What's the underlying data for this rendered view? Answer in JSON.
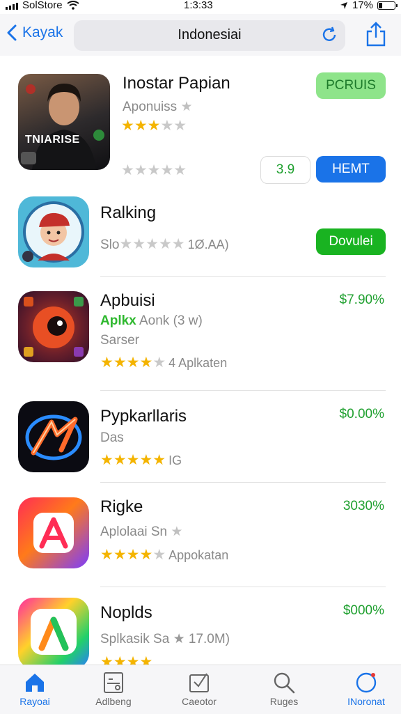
{
  "status_bar": {
    "carrier": "SolStore",
    "time": "1:3:33",
    "battery": "17%"
  },
  "nav": {
    "back_label": "Kayak",
    "url": "Indonesiai"
  },
  "apps": [
    {
      "title": "Inostar Papian",
      "subtitle": "Aponuiss",
      "rating_text": "",
      "secondary_rating_text": "",
      "button_top": "PCRUIS",
      "price_box": "3.9",
      "button_bottom": "HEMT"
    },
    {
      "title": "Ralking",
      "rating_prefix": "Slo",
      "rating_text": "1Ø.AA)",
      "button": "Dovulei"
    },
    {
      "title": "Apbuisi",
      "subtitle_green": "Aplkx",
      "subtitle_gray": "Aonk (3 w)",
      "subtitle2": "Sarser",
      "rating_text": "4 Aplkaten",
      "price": "$7.90%"
    },
    {
      "title": "Pypkarllaris",
      "subtitle": "Das",
      "rating_text": "IG",
      "price": "$0.00%"
    },
    {
      "title": "Rigke",
      "subtitle": "Aplolaai Sn",
      "rating_text": "Appokatan",
      "price": "3030%"
    },
    {
      "title": "Noplds",
      "subtitle": "Splkasik Sa",
      "rating_text": "17.0M)",
      "price": "$000%"
    }
  ],
  "icon_texts": {
    "app1_banner": "TNIARISE"
  },
  "tabs": [
    {
      "label": "Rayoai",
      "icon": "home-icon",
      "active": true
    },
    {
      "label": "Adlbeng",
      "icon": "card-icon",
      "active": false
    },
    {
      "label": "Caeotor",
      "icon": "edit-icon",
      "active": false
    },
    {
      "label": "Ruges",
      "icon": "search-icon",
      "active": false
    },
    {
      "label": "INoronat",
      "icon": "profile-icon",
      "active": false
    }
  ],
  "colors": {
    "accent_blue": "#1a73e8",
    "green": "#1fa02f",
    "star": "#f4b400"
  }
}
